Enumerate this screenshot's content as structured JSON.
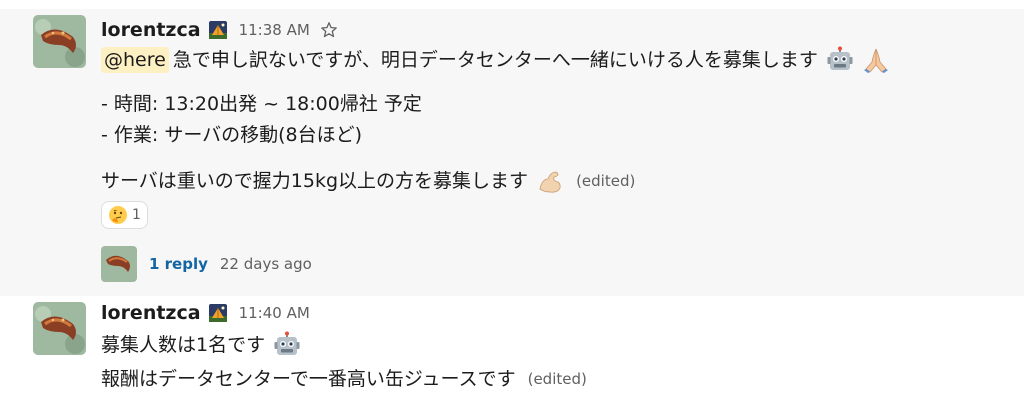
{
  "messages": [
    {
      "user": "lorentzca",
      "time": "11:38 AM",
      "mention": "@here",
      "line1": "急で申し訳ないですが、明日データセンターへ一緒にいける人を募集します",
      "line2": "- 時間: 13:20出発 ~ 18:00帰社 予定",
      "line3": "- 作業: サーバの移動(8台ほど)",
      "line4": "サーバは重いので握力15kg以上の方を募集します",
      "edited": "(edited)",
      "reaction": {
        "emoji": "thinking-face",
        "count": "1"
      },
      "thread": {
        "replies": "1 reply",
        "time": "22 days ago"
      }
    },
    {
      "user": "lorentzca",
      "time": "11:40 AM",
      "line1": "募集人数は1名です",
      "line2": "報酬はデータセンターで一番高い缶ジュースです",
      "edited": "(edited)"
    }
  ],
  "icons": {
    "status": "camping-icon",
    "star": "star-outline-icon",
    "robot": "robot-face-icon",
    "pray": "folded-hands-icon",
    "muscle": "flexed-biceps-icon"
  }
}
